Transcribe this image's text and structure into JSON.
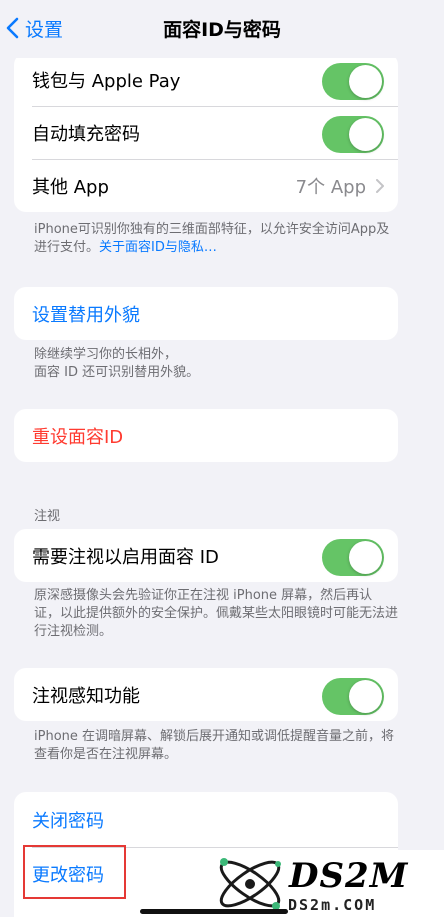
{
  "nav": {
    "back_label": "设置",
    "title": "面容ID与密码"
  },
  "group1": {
    "rows": [
      {
        "label": "钱包与 Apple Pay",
        "toggle": "on"
      },
      {
        "label": "自动填充密码",
        "toggle": "on"
      },
      {
        "label": "其他 App",
        "detail": "7个 App"
      }
    ],
    "footer_text": "iPhone可识别你独有的三维面部特征，以允许安全访问App及进行支付。",
    "footer_link": "关于面容ID与隐私…"
  },
  "alt_appearance": {
    "label": "设置替用外貌",
    "footer_line1": "除继续学习你的长相外，",
    "footer_line2": "面容 ID 还可识别替用外貌。"
  },
  "reset": {
    "label": "重设面容ID"
  },
  "attention": {
    "header": "注视",
    "require_label": "需要注视以启用面容 ID",
    "require_toggle": "on",
    "require_footer": "原深感摄像头会先验证你正在注视 iPhone 屏幕，然后再认证，以此提供额外的安全保护。佩戴某些太阳眼镜时可能无法进行注视检测。",
    "aware_label": "注视感知功能",
    "aware_toggle": "on",
    "aware_footer": "iPhone 在调暗屏幕、解锁后展开通知或调低提醒音量之前，将查看你是否在注视屏幕。"
  },
  "passcode": {
    "turn_off_label": "关闭密码",
    "change_label": "更改密码"
  },
  "watermark": {
    "logo_text": "DS2M",
    "site_text": "DS2m.COM"
  },
  "colors": {
    "accent": "#0a7aff",
    "toggle_on": "#65c466",
    "destructive": "#ff3b30",
    "highlight": "#e53935"
  }
}
